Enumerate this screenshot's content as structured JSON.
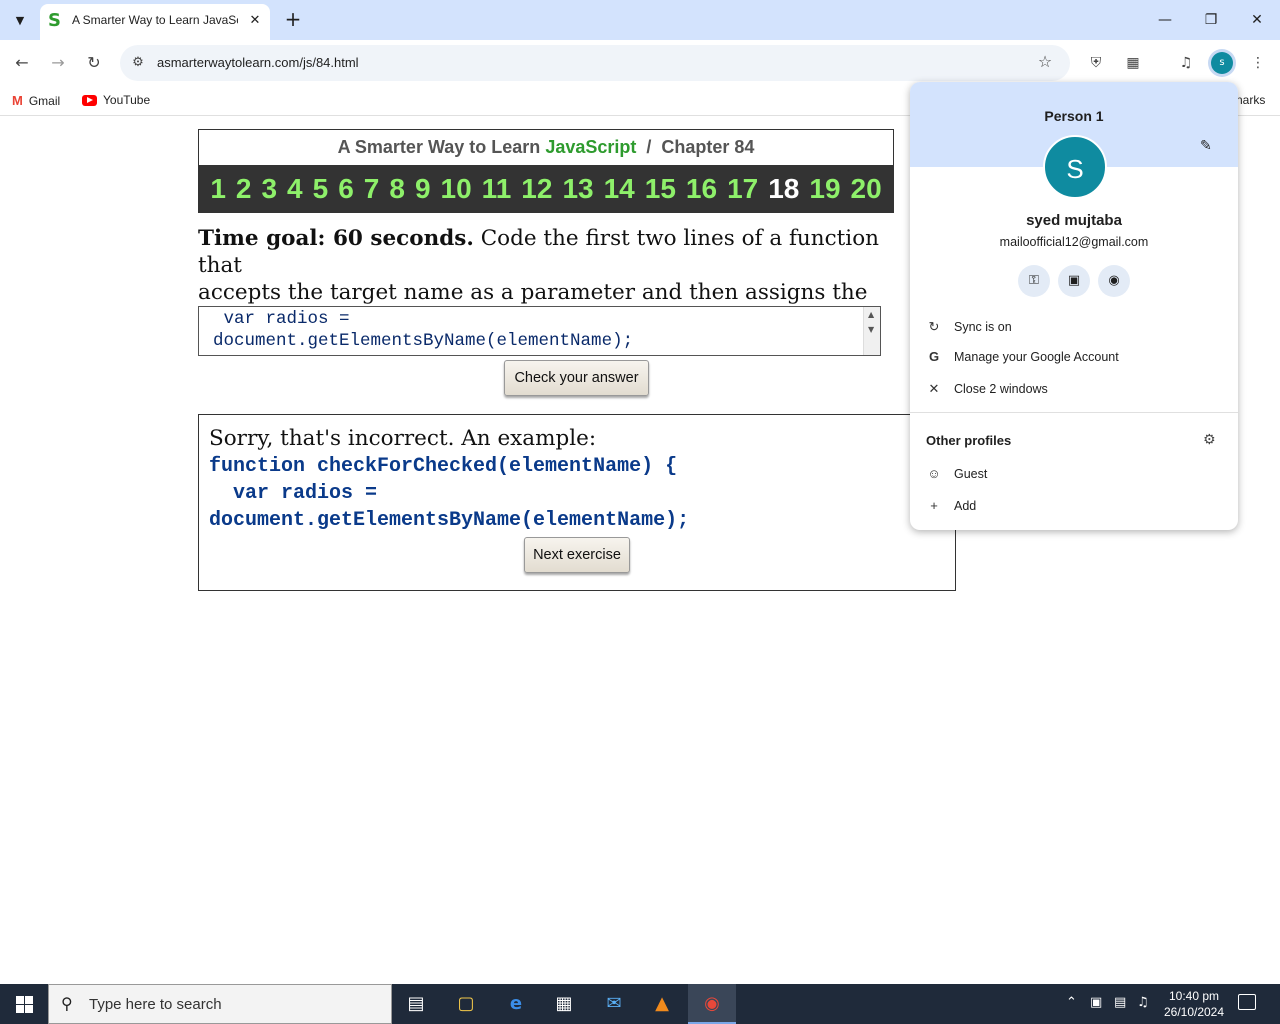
{
  "browser": {
    "tab_title": "A Smarter Way to Learn JavaScr",
    "tab_favicon": "S",
    "tab_close": "✕",
    "new_tab": "+",
    "url": "asmarterwaytolearn.com/js/84.html",
    "profile_initial": "s",
    "bookmarks": [
      {
        "label": "Gmail"
      },
      {
        "label": "YouTube"
      }
    ],
    "bookmarks_right": "narks"
  },
  "page": {
    "header_prefix": "A Smarter Way to Learn ",
    "header_js": "JavaScript",
    "header_suffix": "  /  Chapter 84",
    "chapters": [
      "1",
      "2",
      "3",
      "4",
      "5",
      "6",
      "7",
      "8",
      "9",
      "10",
      "11",
      "12",
      "13",
      "14",
      "15",
      "16",
      "17",
      "18",
      "19",
      "20"
    ],
    "current_chapter": "18",
    "time_goal": "Time goal: 60 seconds.",
    "prompt_text": " Code the first two lines of a function that\naccepts the target name as a parameter and then assigns the value of\nthe target to a variable.",
    "answer_text": " var radios =\ndocument.getElementsByName(elementName);",
    "check_button": "Check your answer",
    "result_message": "Sorry, that's incorrect. An example:",
    "result_code": "function checkForChecked(elementName) {\n  var radios =\ndocument.getElementsByName(elementName);",
    "next_button": "Next exercise"
  },
  "profile_menu": {
    "person": "Person 1",
    "avatar_initial": "S",
    "name": "syed mujtaba",
    "email": "mailoofficial12@gmail.com",
    "rows": [
      {
        "label": "Sync is on",
        "icon": "sync-icon"
      },
      {
        "label": "Manage your Google Account",
        "icon": "google-icon"
      },
      {
        "label": "Close 2 windows",
        "icon": "close-icon"
      }
    ],
    "other_profiles": "Other profiles",
    "profiles": [
      {
        "label": "Guest",
        "icon": "guest-icon"
      },
      {
        "label": "Add",
        "icon": "add-icon"
      }
    ]
  },
  "taskbar": {
    "search_placeholder": "Type here to search",
    "time": "10:40 pm",
    "date": "26/10/2024"
  },
  "colors": {
    "accent_green": "#8ef06a",
    "js_green": "#2e9b2e",
    "avatar": "#0f8ba0",
    "code_blue": "#0a3a8a"
  }
}
